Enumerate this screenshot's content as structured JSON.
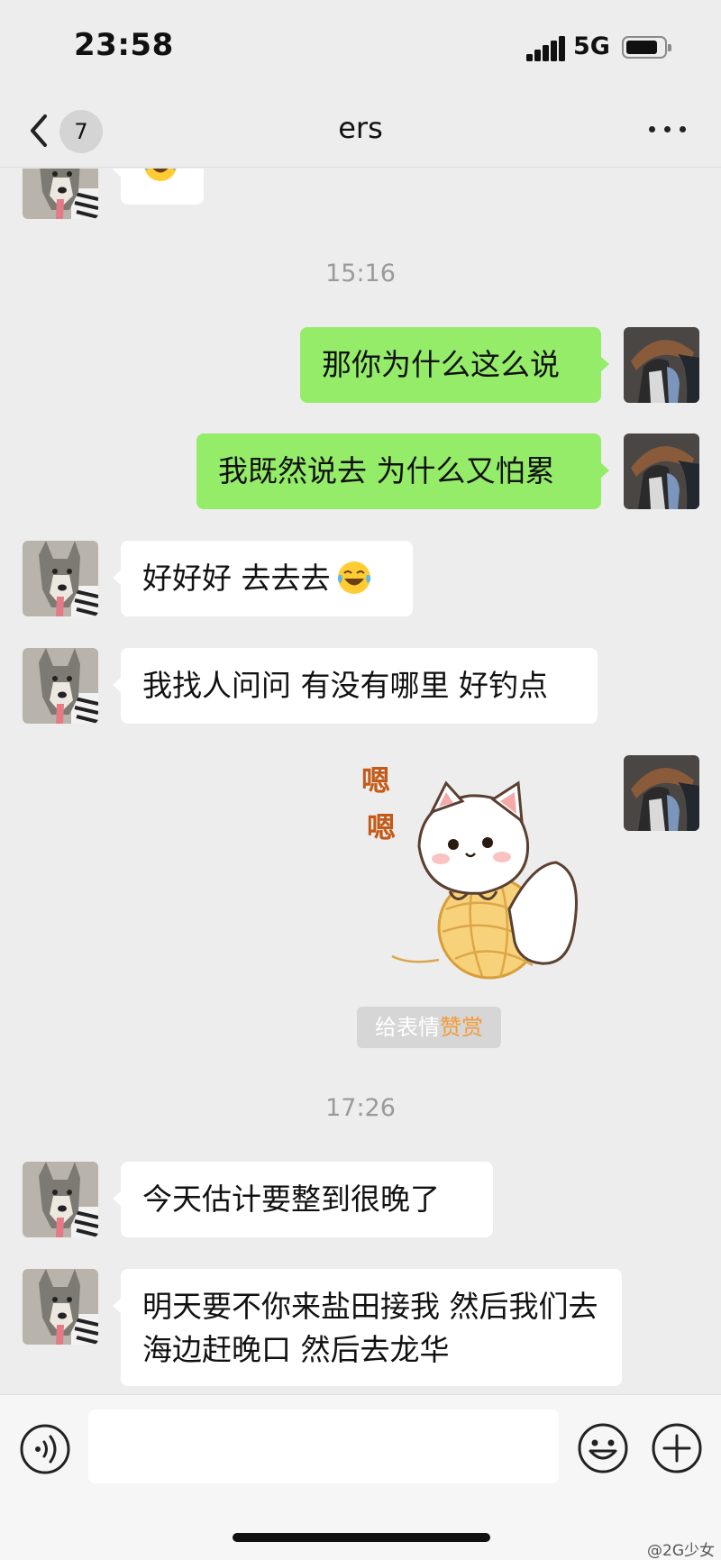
{
  "status": {
    "time": "23:58",
    "network": "5G"
  },
  "nav": {
    "back_badge": "7",
    "title": "ers"
  },
  "messages": {
    "ts1": "15:16",
    "m1": "那你为什么这么说",
    "m2": "我既然说去 为什么又怕累",
    "m3": "好好好 去去去",
    "m4": "我找人问问 有没有哪里 好钓点",
    "sticker_text": "嗯嗯",
    "ts2": "17:26",
    "m5": "今天估计要整到很晚了",
    "m6": "明天要不你来盐田接我 然后我们去海边赶晚口 然后去龙华"
  },
  "reward": {
    "prefix": "给表情",
    "highlight": "赞赏"
  },
  "icons": {
    "back": "chevron-left-icon",
    "more": "more-dots-icon",
    "voice": "voice-icon",
    "emoji": "face-smile-icon",
    "plus": "plus-circle-icon",
    "laugh": "tears-of-joy-emoji"
  },
  "colors": {
    "outgoing_bubble": "#95ec69",
    "incoming_bubble": "#ffffff",
    "background": "#ededed",
    "reward_highlight": "#f29b38"
  },
  "watermark": "@2G少女"
}
